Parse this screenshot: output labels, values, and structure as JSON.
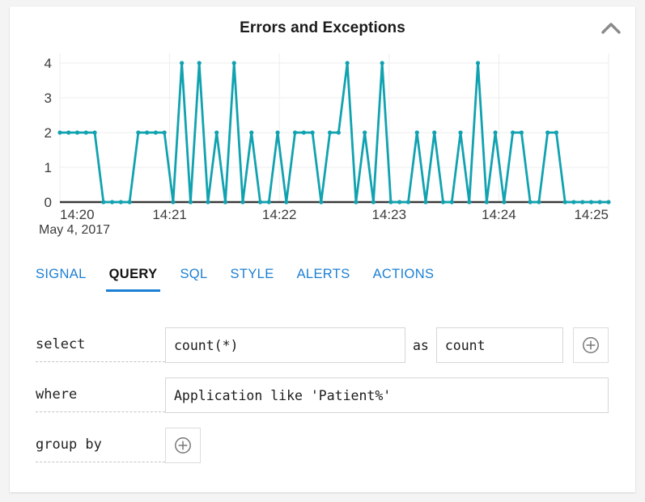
{
  "panel": {
    "title": "Errors and Exceptions",
    "collapse_icon": "chevron-up-icon"
  },
  "chart_data": {
    "type": "line",
    "title": "Errors and Exceptions",
    "xlabel": "",
    "ylabel": "",
    "date_label": "May 4, 2017",
    "grid": true,
    "legend": null,
    "line_color": "#11a2b0",
    "marker": "circle",
    "ylim": [
      0,
      4
    ],
    "yticks": [
      0,
      1,
      2,
      3,
      4
    ],
    "ytick_labels": [
      "0",
      "1",
      "2",
      "3",
      "4"
    ],
    "xlim": [
      "14:20",
      "14:25"
    ],
    "xticks": [
      "14:20",
      "14:21",
      "14:22",
      "14:23",
      "14:24",
      "14:25"
    ],
    "x_interval_seconds": 5,
    "series": [
      {
        "name": "count",
        "values": [
          2,
          2,
          2,
          2,
          2,
          0,
          0,
          0,
          0,
          2,
          2,
          2,
          2,
          0,
          4,
          0,
          4,
          0,
          2,
          0,
          4,
          0,
          2,
          0,
          0,
          2,
          0,
          2,
          2,
          2,
          0,
          2,
          2,
          4,
          0,
          2,
          0,
          4,
          0,
          0,
          0,
          2,
          0,
          2,
          0,
          0,
          2,
          0,
          4,
          0,
          2,
          0,
          2,
          2,
          0,
          0,
          2,
          2,
          0,
          0,
          0,
          0,
          0,
          0
        ]
      }
    ]
  },
  "tabs": [
    {
      "label": "SIGNAL",
      "active": false
    },
    {
      "label": "QUERY",
      "active": true
    },
    {
      "label": "SQL",
      "active": false
    },
    {
      "label": "STYLE",
      "active": false
    },
    {
      "label": "ALERTS",
      "active": false
    },
    {
      "label": "ACTIONS",
      "active": false
    }
  ],
  "query": {
    "select": {
      "label": "select",
      "expression": "count(*)",
      "expression_placeholder": "",
      "as_label": "as",
      "alias": "count",
      "alias_placeholder": "",
      "add_icon": "plus-circle-icon"
    },
    "where": {
      "label": "where",
      "expression": "Application like 'Patient%'",
      "expression_placeholder": ""
    },
    "group_by": {
      "label": "group by",
      "add_icon": "plus-circle-icon"
    }
  },
  "colors": {
    "accent_blue": "#1b7fd4",
    "series_teal": "#11a2b0",
    "page_background": "#f4f4f5",
    "card_background": "#ffffff",
    "axis": "#3a3a3a",
    "grid": "#ededed"
  }
}
